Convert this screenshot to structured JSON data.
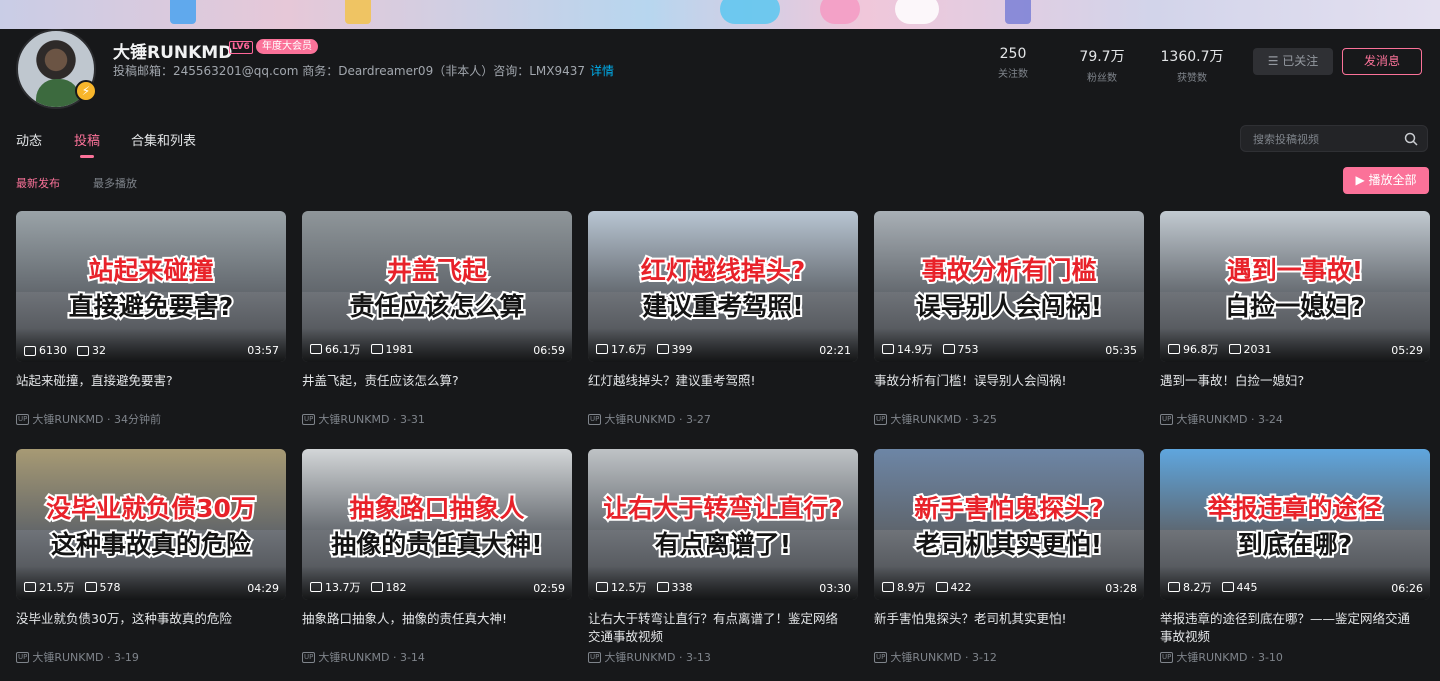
{
  "colors": {
    "accent": "#fb7299",
    "link": "#00aeec",
    "background": "#17181a"
  },
  "header": {
    "name": "大锤RUNKMD",
    "level": "LV6",
    "vip_badge": "年度大会员",
    "sign": "投稿邮箱：245563201@qq.com 商务：Deardreamer09（非本人）咨询：LMX9437",
    "sign_more": "详情",
    "stats": [
      {
        "value": "250",
        "label": "关注数"
      },
      {
        "value": "79.7万",
        "label": "粉丝数"
      },
      {
        "value": "1360.7万",
        "label": "获赞数"
      }
    ],
    "follow_label": "已关注",
    "message_label": "发消息"
  },
  "tabs": [
    "动态",
    "投稿",
    "合集和列表"
  ],
  "search": {
    "placeholder": "搜索投稿视频"
  },
  "sort": {
    "latest": "最新发布",
    "most_played": "最多播放",
    "play_all": "播放全部"
  },
  "videos": [
    {
      "thumb_line1": "站起来碰撞",
      "thumb_line2": "直接避免要害?",
      "views": "6130",
      "danmaku": "32",
      "duration": "03:57",
      "title": "站起来碰撞，直接避免要害?",
      "owner": "大锤RUNKMD",
      "date": "34分钟前",
      "sky": "#9aa3a8"
    },
    {
      "thumb_line1": "井盖飞起",
      "thumb_line2": "责任应该怎么算",
      "views": "66.1万",
      "danmaku": "1981",
      "duration": "06:59",
      "title": "井盖飞起，责任应该怎么算?",
      "owner": "大锤RUNKMD",
      "date": "3-31",
      "sky": "#8f969a"
    },
    {
      "thumb_line1": "红灯越线掉头?",
      "thumb_line2": "建议重考驾照!",
      "views": "17.6万",
      "danmaku": "399",
      "duration": "02:21",
      "title": "红灯越线掉头？建议重考驾照!",
      "owner": "大锤RUNKMD",
      "date": "3-27",
      "sky": "#b9c6d3"
    },
    {
      "thumb_line1": "事故分析有门槛",
      "thumb_line2": "误导别人会闯祸!",
      "views": "14.9万",
      "danmaku": "753",
      "duration": "05:35",
      "title": "事故分析有门槛！误导别人会闯祸!",
      "owner": "大锤RUNKMD",
      "date": "3-25",
      "sky": "#a9b0b6"
    },
    {
      "thumb_line1": "遇到一事故!",
      "thumb_line2": "白捡一媳妇?",
      "views": "96.8万",
      "danmaku": "2031",
      "duration": "05:29",
      "title": "遇到一事故！白捡一媳妇?",
      "owner": "大锤RUNKMD",
      "date": "3-24",
      "sky": "#c2cad1"
    },
    {
      "thumb_line1": "没毕业就负债30万",
      "thumb_line2": "这种事故真的危险",
      "views": "21.5万",
      "danmaku": "578",
      "duration": "04:29",
      "title": "没毕业就负债30万，这种事故真的危险",
      "owner": "大锤RUNKMD",
      "date": "3-19",
      "sky": "#a79a74"
    },
    {
      "thumb_line1": "抽象路口抽象人",
      "thumb_line2": "抽像的责任真大神!",
      "views": "13.7万",
      "danmaku": "182",
      "duration": "02:59",
      "title": "抽象路口抽象人，抽像的责任真大神!",
      "owner": "大锤RUNKMD",
      "date": "3-14",
      "sky": "#d3d6d8"
    },
    {
      "thumb_line1": "让右大于转弯让直行?",
      "thumb_line2": "有点离谱了!",
      "views": "12.5万",
      "danmaku": "338",
      "duration": "03:30",
      "title": "让右大于转弯让直行？有点离谱了！鉴定网络交通事故视频",
      "owner": "大锤RUNKMD",
      "date": "3-13",
      "sky": "#bfc3c6"
    },
    {
      "thumb_line1": "新手害怕鬼探头?",
      "thumb_line2": "老司机其实更怕!",
      "views": "8.9万",
      "danmaku": "422",
      "duration": "03:28",
      "title": "新手害怕鬼探头？老司机其实更怕!",
      "owner": "大锤RUNKMD",
      "date": "3-12",
      "sky": "#6d86a6"
    },
    {
      "thumb_line1": "举报违章的途径",
      "thumb_line2": "到底在哪?",
      "views": "8.2万",
      "danmaku": "445",
      "duration": "06:26",
      "title": "举报违章的途径到底在哪？——鉴定网络交通事故视频",
      "owner": "大锤RUNKMD",
      "date": "3-10",
      "sky": "#5fa6de"
    }
  ]
}
